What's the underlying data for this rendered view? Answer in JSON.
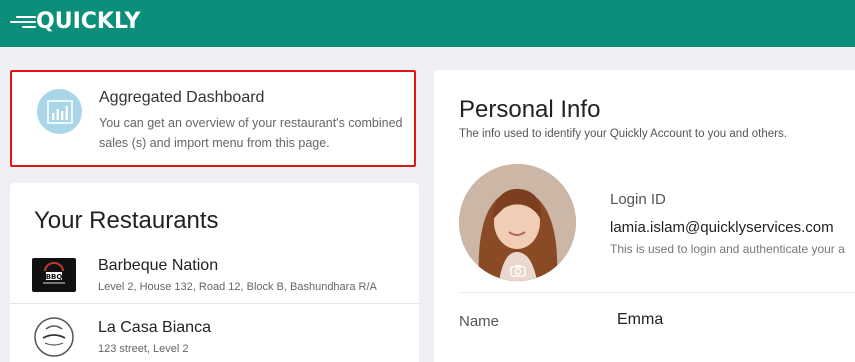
{
  "brand": {
    "logo_text": "QUICKLY",
    "color": "#0b8f7b"
  },
  "aggregated": {
    "title": "Aggregated Dashboard",
    "description": "You can get an overview of your restaurant's combined sales (s) and import menu from this page.",
    "icon": "bar-chart-icon"
  },
  "restaurants": {
    "heading": "Your Restaurants",
    "items": [
      {
        "name": "Barbeque Nation",
        "address": "Level 2, House 132, Road 12, Block B, Bashundhara R/A",
        "logo": "bbq-logo"
      },
      {
        "name": "La Casa Bianca",
        "address": "123 street, Level 2",
        "logo": "la-casa-bianca-logo"
      }
    ]
  },
  "personal_info": {
    "heading": "Personal Info",
    "subtitle": "The info used to identify your Quickly Account to you and others.",
    "login_label": "Login ID",
    "login_value": "lamia.islam@quicklyservices.com",
    "login_help": "This is used to login and authenticate your a",
    "name_label": "Name",
    "name_value": "Emma"
  }
}
